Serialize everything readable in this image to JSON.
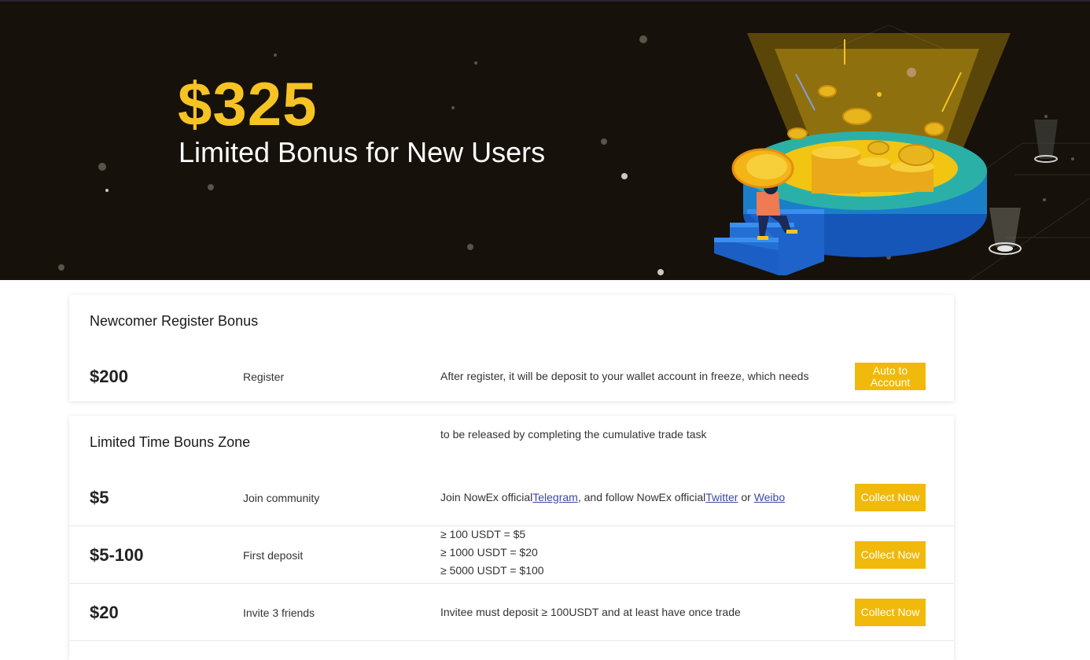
{
  "hero": {
    "amount": "$325",
    "subtitle": "Limited Bonus for New Users",
    "accent_color": "#f6c324",
    "background_color": "#16110a",
    "illustration": "coin-platform-illustration"
  },
  "register_section": {
    "title": "Newcomer Register Bonus",
    "row": {
      "amount": "$200",
      "task": "Register",
      "description_line1": "After register, it will be deposit to your wallet account in freeze, which needs",
      "description_line2": "to be released by completing the cumulative trade task",
      "button_label": "Auto to Account"
    }
  },
  "limited_section": {
    "title": "Limited Time Bouns Zone",
    "rows": [
      {
        "amount": "$5",
        "task": "Join community",
        "desc_prefix": "Join NowEx official",
        "link_telegram": "Telegram",
        "desc_mid": ", and follow NowEx official",
        "link_twitter": "Twitter",
        "desc_or": " or ",
        "link_weibo": "Weibo",
        "button_label": "Collect Now"
      },
      {
        "amount": "$5-100",
        "task": "First deposit",
        "tiers": [
          "≥ 100 USDT = $5",
          "≥ 1000 USDT = $20",
          "≥ 5000 USDT = $100"
        ],
        "button_label": "Collect Now"
      },
      {
        "amount": "$20",
        "task": "Invite 3 friends",
        "description": "Invitee must deposit ≥ 100USDT and at least have once trade",
        "button_label": "Collect Now"
      }
    ]
  },
  "colors": {
    "button": "#f0b90b",
    "link": "#3b4aa0"
  }
}
